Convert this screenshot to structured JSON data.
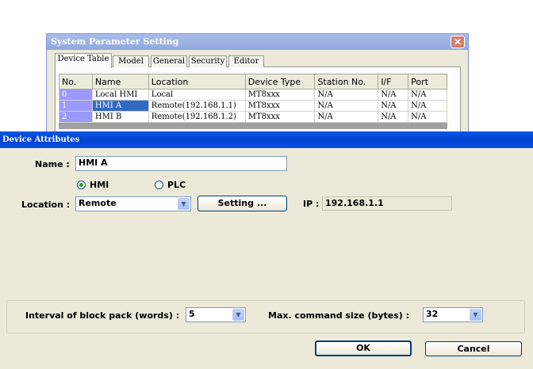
{
  "background_window": {
    "title": "System Parameter Setting",
    "close_glyph": "✕",
    "tabs": [
      "Device Table",
      "Model",
      "General",
      "Security",
      "Editor"
    ],
    "table": {
      "columns": [
        "No.",
        "Name",
        "Location",
        "Device Type",
        "Station No.",
        "I/F",
        "Port"
      ],
      "rows": [
        [
          "0",
          "Local HMI",
          "Local",
          "MT8xxx",
          "N/A",
          "N/A",
          "N/A"
        ],
        [
          "1",
          "HMI A",
          "Remote(192.168.1.1)",
          "MT8xxx",
          "N/A",
          "N/A",
          "N/A"
        ],
        [
          "2",
          "HMI B",
          "Remote(192.168.1.2)",
          "MT8xxx",
          "N/A",
          "N/A",
          "N/A"
        ]
      ],
      "selected_row": 1
    }
  },
  "dialog": {
    "title": "Device Attributes",
    "name_label": "Name :",
    "name_value": "HMI A",
    "radio_hmi": "HMI",
    "radio_plc": "PLC",
    "selected_type": "HMI",
    "location_label": "Location :",
    "location_value": "Remote",
    "setting_button": "Setting ...",
    "ip_label": "IP :",
    "ip_value": "192.168.1.1",
    "interval_label": "Interval of block pack (words) :",
    "interval_value": "5",
    "max_cmd_label": "Max. command size (bytes) :",
    "max_cmd_value": "32",
    "ok_button": "OK",
    "cancel_button": "Cancel",
    "dropdown_glyph": "▼"
  },
  "colors": {
    "titlebar_blue": "#0343d3",
    "dialog_face": "#ece9d8",
    "selection": "#316ac5",
    "index_cell": "#9999ff"
  }
}
